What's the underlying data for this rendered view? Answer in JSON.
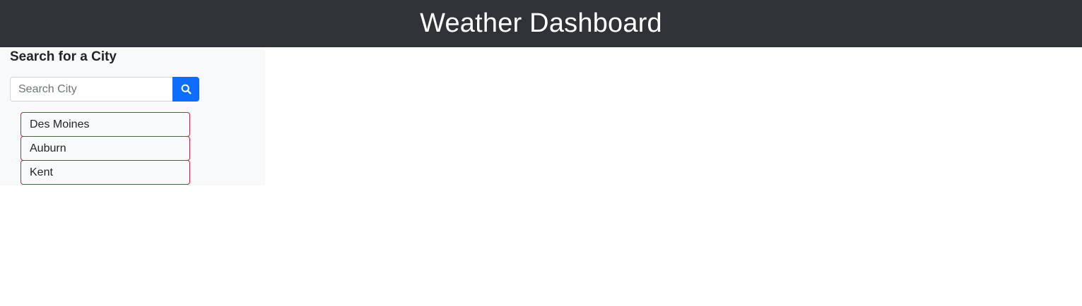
{
  "header": {
    "title": "Weather Dashboard"
  },
  "sidebar": {
    "heading": "Search for a City",
    "search": {
      "placeholder": "Search City",
      "value": "",
      "button_icon": "search-icon"
    },
    "history": [
      {
        "label": "Des Moines"
      },
      {
        "label": "Auburn"
      },
      {
        "label": "Kent"
      }
    ]
  },
  "colors": {
    "header_bg": "#2f3237",
    "sidebar_bg": "#f8f9fa",
    "search_button": "#0d6efd",
    "history_border": "#c82333"
  }
}
